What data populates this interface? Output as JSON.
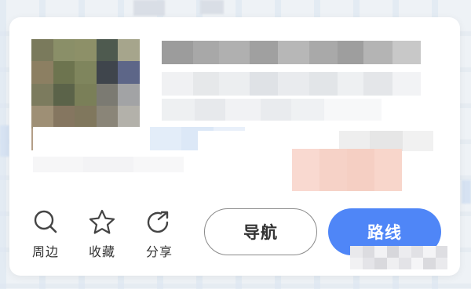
{
  "actions": [
    {
      "id": "nearby",
      "label": "周边",
      "icon": "search-icon"
    },
    {
      "id": "favorite",
      "label": "收藏",
      "icon": "star-icon"
    },
    {
      "id": "share",
      "label": "分享",
      "icon": "share-icon"
    }
  ],
  "buttons": {
    "navigate_label": "导航",
    "route_label": "路线"
  },
  "colors": {
    "primary": "#4f86f7",
    "text": "#333333",
    "card_bg": "#ffffff"
  }
}
